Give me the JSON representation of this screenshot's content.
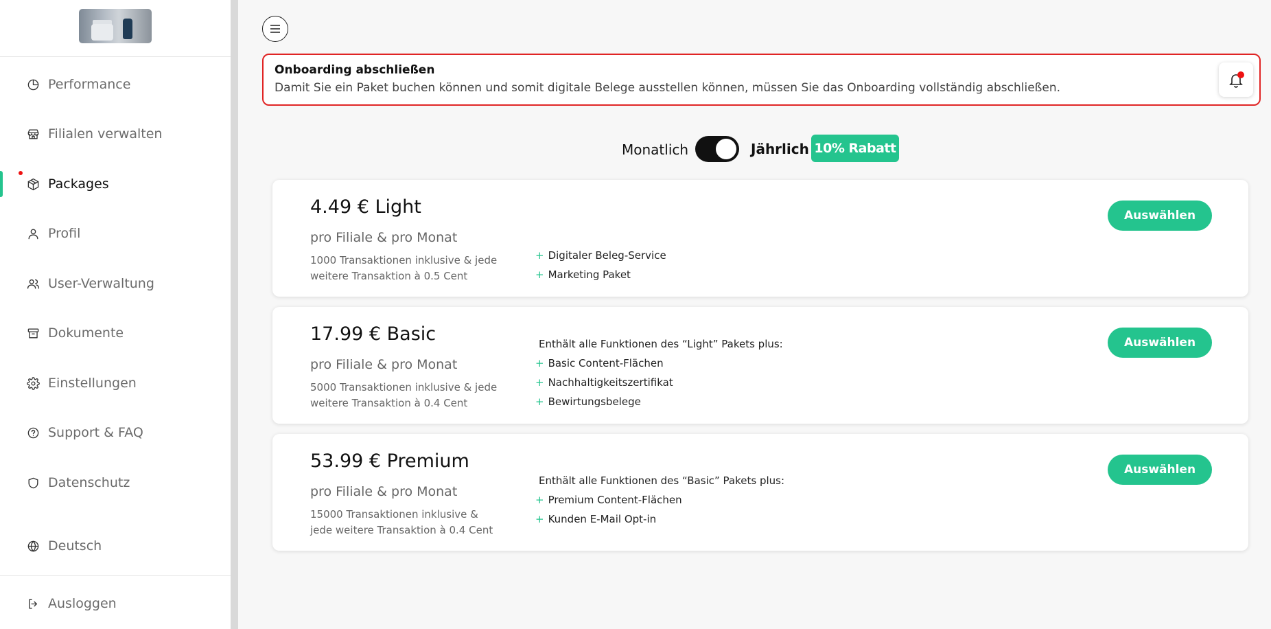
{
  "sidebar": {
    "items": [
      {
        "label": "Performance",
        "icon": "pie-chart-icon"
      },
      {
        "label": "Filialen verwalten",
        "icon": "store-icon"
      },
      {
        "label": "Packages",
        "icon": "package-icon"
      },
      {
        "label": "Profil",
        "icon": "user-icon"
      },
      {
        "label": "User-Verwaltung",
        "icon": "users-icon"
      },
      {
        "label": "Dokumente",
        "icon": "archive-icon"
      },
      {
        "label": "Einstellungen",
        "icon": "gear-icon"
      },
      {
        "label": "Support & FAQ",
        "icon": "help-circle-icon"
      },
      {
        "label": "Datenschutz",
        "icon": "shield-icon"
      },
      {
        "label": "Deutsch",
        "icon": "globe-icon"
      },
      {
        "label": "Ausloggen",
        "icon": "logout-icon"
      }
    ],
    "active_item": "Packages"
  },
  "alert": {
    "title": "Onboarding abschließen",
    "text": "Damit Sie ein Paket buchen können und somit digitale Belege ausstellen können, müssen Sie das Onboarding vollständig abschließen."
  },
  "billing": {
    "monthly_label": "Monatlich",
    "yearly_label": "Jährlich",
    "discount_badge": "10% Rabatt",
    "yearly_selected": true
  },
  "packages": [
    {
      "title": "4.49 € Light",
      "subtitle": "pro Filiale & pro Monat",
      "transactions": "1000 Transaktionen inklusive & jede weitere Transaktion à 0.5 Cent",
      "intro": "",
      "features": [
        "Digitaler Beleg-Service",
        "Marketing Paket"
      ],
      "button": "Auswählen"
    },
    {
      "title": "17.99 € Basic",
      "subtitle": "pro Filiale & pro Monat",
      "transactions": "5000 Transaktionen inklusive & jede weitere Transaktion à 0.4 Cent",
      "intro": "Enthält alle Funktionen des “Light” Pakets plus:",
      "features": [
        "Basic Content-Flächen",
        "Nachhaltigkeitszertifikat",
        "Bewirtungsbelege"
      ],
      "button": "Auswählen"
    },
    {
      "title": "53.99 € Premium",
      "subtitle": "pro Filiale & pro Monat",
      "transactions": "15000 Transaktionen inklusive & jede weitere Transaktion à 0.4 Cent",
      "intro": "Enthält alle Funktionen des “Basic” Pakets plus:",
      "features": [
        "Premium Content-Flächen",
        "Kunden E-Mail Opt-in"
      ],
      "button": "Auswählen"
    }
  ],
  "colors": {
    "accent": "#24c48e",
    "alert_border": "#e02424",
    "notification_dot": "#ee1111"
  }
}
